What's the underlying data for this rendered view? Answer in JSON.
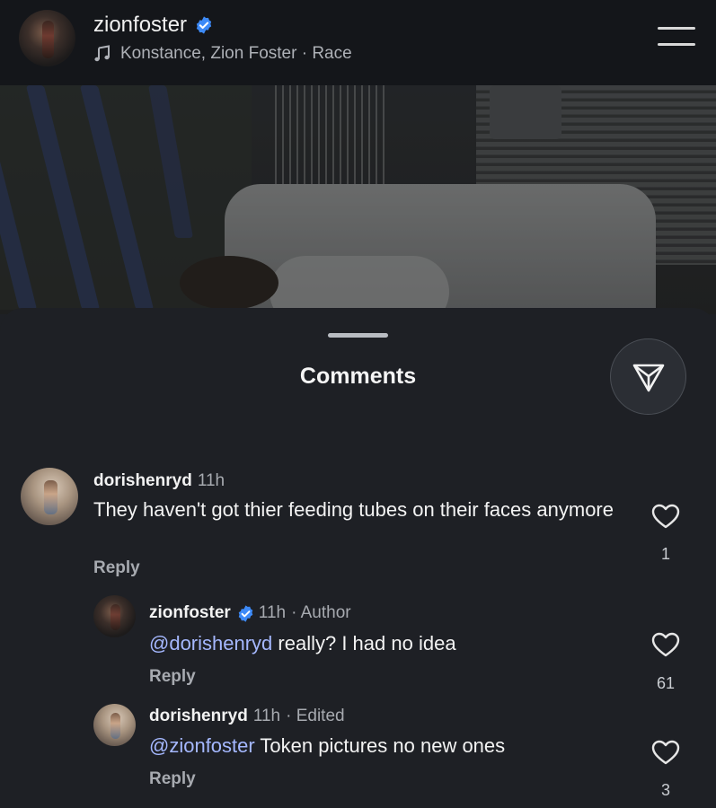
{
  "header": {
    "username": "zionfoster",
    "verified": true,
    "music": "Konstance, Zion Foster · Race",
    "icons": {
      "music": "music-note-icon",
      "menu": "menu-icon",
      "verified": "verified-badge-icon"
    }
  },
  "sheet": {
    "title": "Comments",
    "share_icon": "send-icon"
  },
  "comments": [
    {
      "username": "dorishenryd",
      "time": "11h",
      "meta": "",
      "mention": "",
      "text": "They haven't got thier feeding tubes on their faces anymore",
      "reply_label": "Reply",
      "likes": "1"
    },
    {
      "username": "zionfoster",
      "verified": true,
      "time": "11h",
      "meta": "· Author",
      "mention": "@dorishenryd",
      "text": " really? I had no idea",
      "reply_label": "Reply",
      "likes": "61"
    },
    {
      "username": "dorishenryd",
      "time": "11h",
      "meta": "· Edited",
      "mention": "@zionfoster",
      "text": " Token pictures no new ones",
      "reply_label": "Reply",
      "likes": "3"
    }
  ],
  "colors": {
    "background": "#1e2025",
    "header_bg": "#14161a",
    "mention": "#a5b8ff",
    "verified": "#3d8af7"
  }
}
